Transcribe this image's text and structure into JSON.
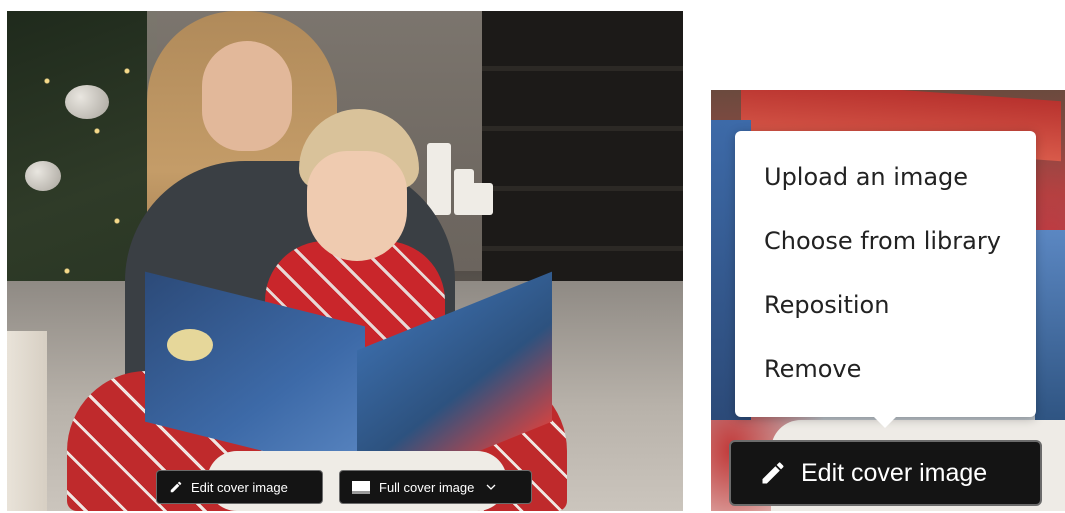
{
  "left_panel": {
    "toolbar": {
      "edit_label": "Edit cover image",
      "edit_icon": "pencil-icon",
      "full_label": "Full cover image",
      "full_icon": "cover-layout-icon",
      "full_dropdown_icon": "chevron-down-icon"
    }
  },
  "right_panel": {
    "menu": {
      "items": [
        {
          "label": "Upload an image"
        },
        {
          "label": "Choose from library"
        },
        {
          "label": "Reposition"
        },
        {
          "label": "Remove"
        }
      ]
    },
    "edit_button": {
      "label": "Edit cover image",
      "icon": "pencil-icon"
    }
  },
  "colors": {
    "button_bg": "#141414",
    "button_border": "#6b6b6b",
    "button_text": "#ffffff",
    "menu_bg": "#ffffff",
    "menu_text": "#222222"
  }
}
